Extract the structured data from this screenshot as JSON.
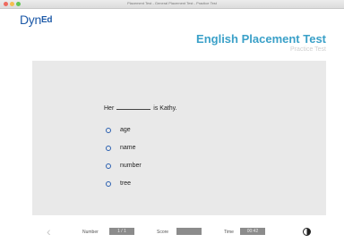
{
  "window": {
    "title": "Placement Test - General Placement Test - Practice Test"
  },
  "header": {
    "logo_main": "Dyn",
    "logo_accent": "Ed",
    "title": "English Placement Test",
    "subtitle": "Practice Test"
  },
  "question": {
    "before": "Her",
    "after": "is Kathy.",
    "options": [
      "age",
      "name",
      "number",
      "tree"
    ]
  },
  "footer": {
    "number_label": "Number",
    "number_value": "1 / 1",
    "score_label": "Score",
    "score_value": "",
    "time_label": "Time",
    "time_value": "00:42"
  }
}
